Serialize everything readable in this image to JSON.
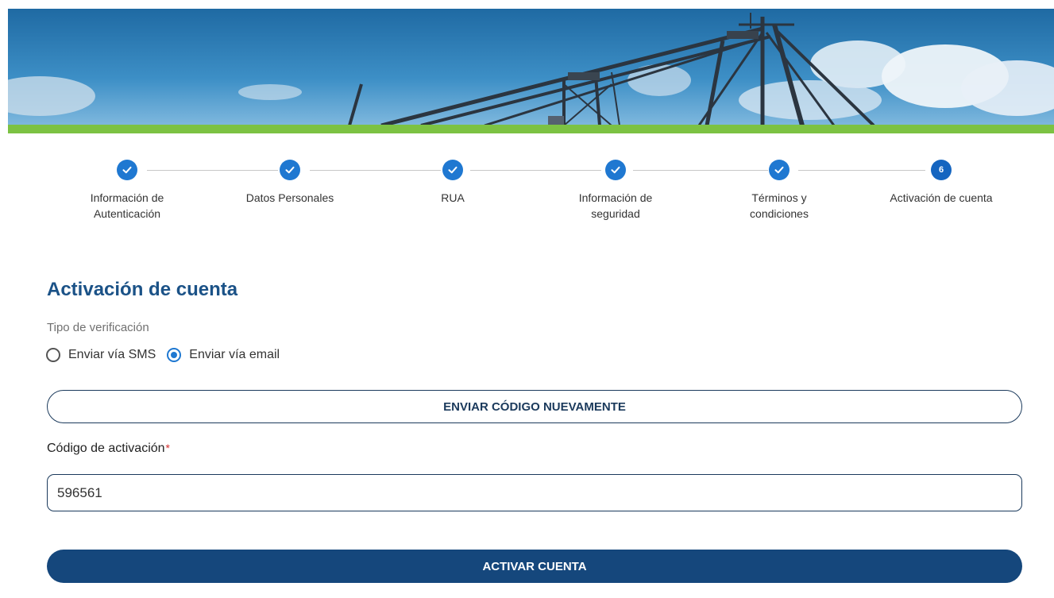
{
  "colors": {
    "primary": "#15477c",
    "step_blue": "#1f78d1",
    "green_accent": "#7cc243",
    "title_blue": "#1b5287"
  },
  "stepper": {
    "steps": [
      {
        "label": "Información de\nAutenticación",
        "status": "complete",
        "icon": "check-icon"
      },
      {
        "label": "Datos Personales",
        "status": "complete",
        "icon": "check-icon"
      },
      {
        "label": "RUA",
        "status": "complete",
        "icon": "check-icon"
      },
      {
        "label": "Información de\nseguridad",
        "status": "complete",
        "icon": "check-icon"
      },
      {
        "label": "Términos y\ncondiciones",
        "status": "complete",
        "icon": "check-icon"
      },
      {
        "label": "Activación de cuenta",
        "status": "active",
        "number": "6"
      }
    ]
  },
  "form": {
    "title": "Activación de cuenta",
    "verification_label": "Tipo de verificación",
    "options": [
      {
        "label": "Enviar vía SMS",
        "selected": false
      },
      {
        "label": "Enviar vía email",
        "selected": true
      }
    ],
    "resend_button": "ENVIAR CÓDIGO NUEVAMENTE",
    "code_label": "Código de activación",
    "required_mark": "*",
    "code_value": "596561",
    "submit_button": "ACTIVAR CUENTA"
  }
}
